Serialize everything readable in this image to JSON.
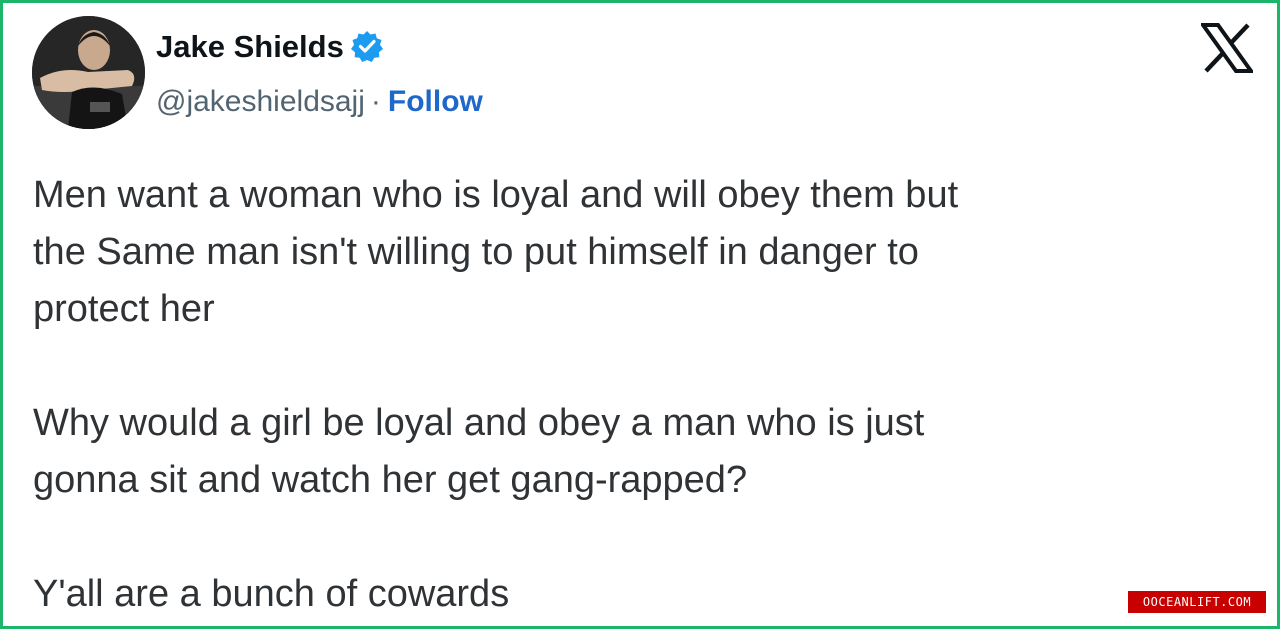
{
  "author": {
    "display_name": "Jake Shields",
    "handle": "@jakeshieldsajj",
    "separator": "·",
    "follow_label": "Follow",
    "verified": true,
    "avatar_icon": "profile-photo"
  },
  "brand": {
    "logo_icon": "x-logo-icon"
  },
  "tweet": {
    "paragraphs": [
      {
        "lines": [
          "Men want a woman who is loyal and will obey them but",
          "the Same man isn't willing to put himself in danger to",
          "protect her"
        ]
      },
      {
        "lines": [
          "Why would a girl be loyal and obey a man who is just",
          "gonna sit and watch her get gang-rapped?"
        ]
      },
      {
        "lines": [
          "Y'all are a bunch of cowards"
        ]
      }
    ]
  },
  "watermark": {
    "text": "OOCEANLIFT.COM"
  },
  "colors": {
    "frame_border": "#1db56a",
    "follow_link": "#1d68c9",
    "verified_badge": "#1d9bf0",
    "watermark_bg": "#c80000"
  }
}
